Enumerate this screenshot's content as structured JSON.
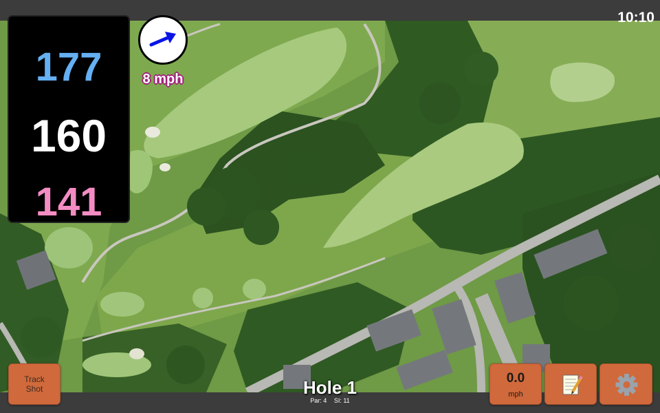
{
  "status": {
    "time": "10:10"
  },
  "distances": {
    "back": {
      "value": "177",
      "color": "#64b0f2"
    },
    "middle": {
      "value": "160",
      "color": "#ffffff"
    },
    "front": {
      "value": "141",
      "color": "#f48cc4"
    }
  },
  "wind": {
    "label": "8 mph",
    "arrow_color": "#0a14e6"
  },
  "buttons": {
    "track_shot": "Track Shot",
    "wind_value": "0.0",
    "wind_unit": "mph",
    "notes_icon": "notepad-icon",
    "settings_icon": "gear-icon"
  },
  "hole": {
    "title": "Hole 1",
    "par": "Par: 4",
    "si": "SI: 11"
  },
  "colors": {
    "button": "#d0693b",
    "bar": "#3c3c3c"
  }
}
